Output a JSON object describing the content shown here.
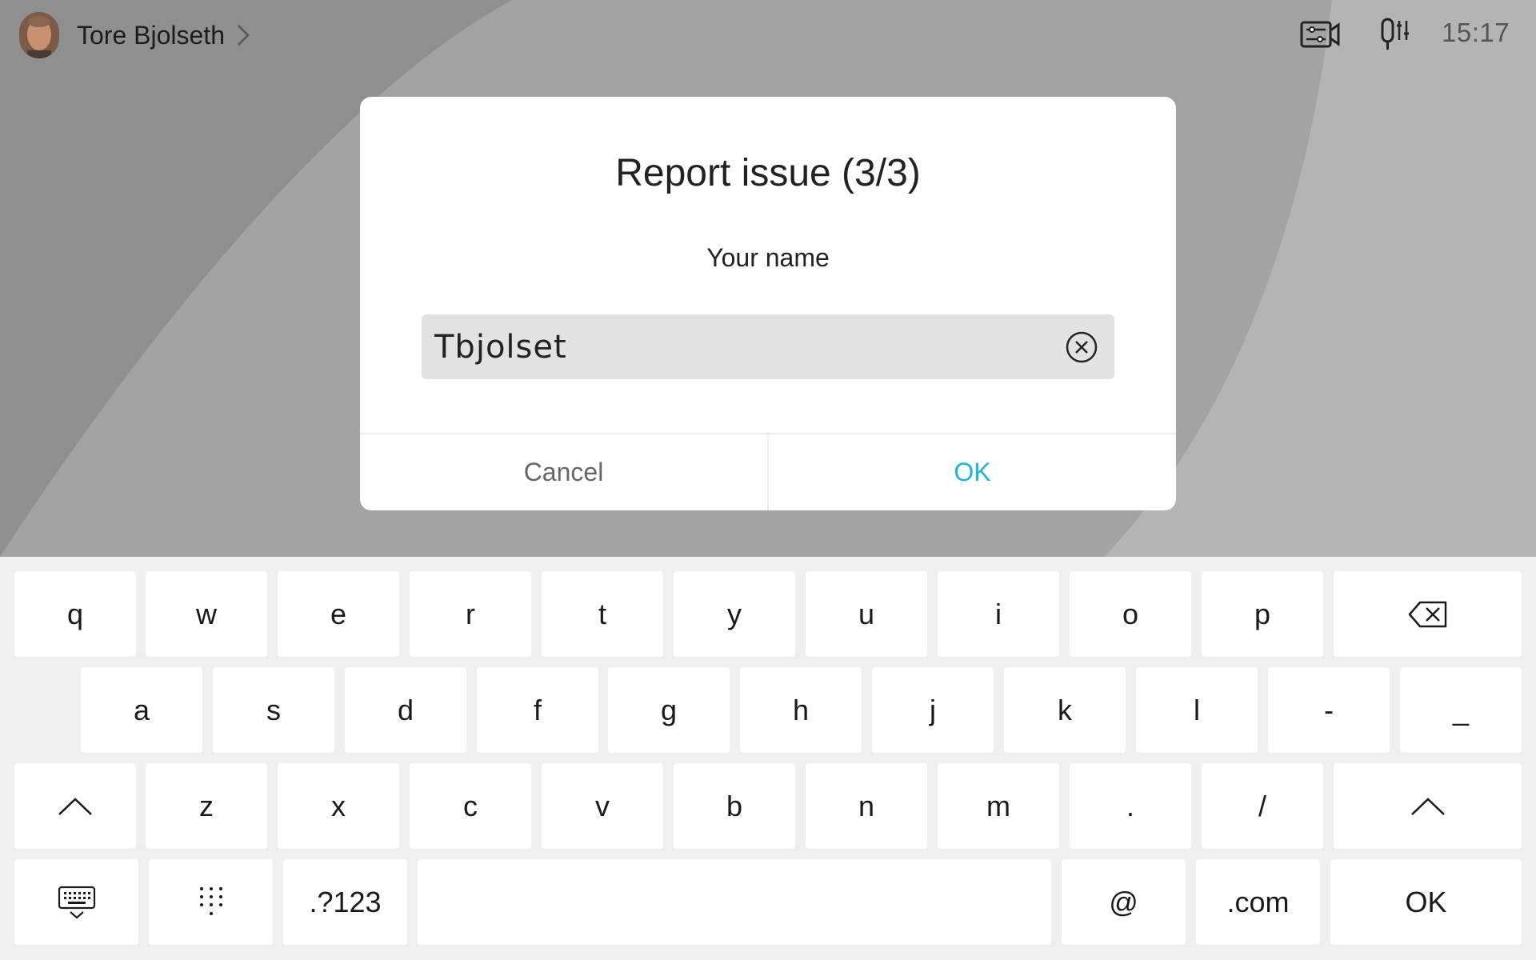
{
  "header": {
    "user_name": "Tore Bjolseth",
    "time": "15:17"
  },
  "icons": {
    "camera_settings": "camera-settings-icon",
    "audio_settings": "audio-settings-icon"
  },
  "dialog": {
    "title": "Report issue (3/3)",
    "field_label": "Your name",
    "input_value": "Tbjolset",
    "cancel_label": "Cancel",
    "ok_label": "OK"
  },
  "keyboard": {
    "row1": [
      "q",
      "w",
      "e",
      "r",
      "t",
      "y",
      "u",
      "i",
      "o",
      "p"
    ],
    "row2": [
      "a",
      "s",
      "d",
      "f",
      "g",
      "h",
      "j",
      "k",
      "l",
      "-",
      "_"
    ],
    "row3": [
      "z",
      "x",
      "c",
      "v",
      "b",
      "n",
      "m",
      ".",
      "/"
    ],
    "numbers_label": ".?123",
    "at_label": "@",
    "com_label": ".com",
    "ok_label": "OK"
  },
  "colors": {
    "accent": "#1bb5d9",
    "dialog_bg": "#ffffff",
    "keyboard_bg": "#efefef"
  }
}
